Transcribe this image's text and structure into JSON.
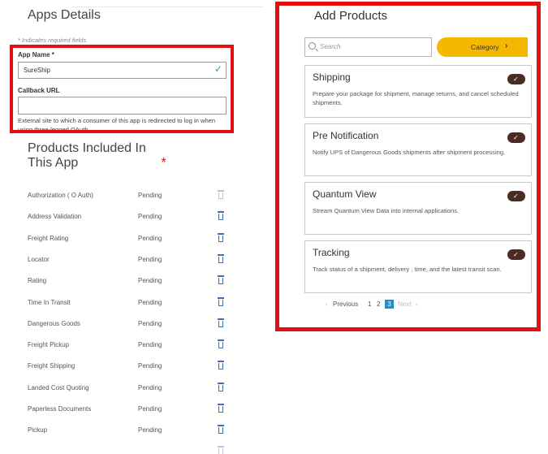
{
  "apps_details": {
    "title": "Apps Details",
    "required_note": "* Indicates required fields",
    "app_name_label": "App Name *",
    "app_name_value": "SureShip",
    "callback_label": "Callback URL",
    "callback_value": "",
    "callback_help": "External site to which a consumer of this app is redirected to log in when using three-legged OAuth"
  },
  "products_included": {
    "heading": "Products Included In This App",
    "required_star": "*",
    "rows": [
      {
        "name": "Authorization ( O Auth)",
        "status": "Pending",
        "removable": false
      },
      {
        "name": "Address Validation",
        "status": "Pending",
        "removable": true
      },
      {
        "name": "Freight Rating",
        "status": "Pending",
        "removable": true
      },
      {
        "name": "Locator",
        "status": "Pending",
        "removable": true
      },
      {
        "name": "Rating",
        "status": "Pending",
        "removable": true
      },
      {
        "name": "Time In Transit",
        "status": "Pending",
        "removable": true
      },
      {
        "name": "Dangerous Goods",
        "status": "Pending",
        "removable": true
      },
      {
        "name": "Freight Pickup",
        "status": "Pending",
        "removable": true
      },
      {
        "name": "Freight Shipping",
        "status": "Pending",
        "removable": true
      },
      {
        "name": "Landed Cost Quoting",
        "status": "Pending",
        "removable": true
      },
      {
        "name": "Paperless Documents",
        "status": "Pending",
        "removable": true
      },
      {
        "name": "Pickup",
        "status": "Pending",
        "removable": true
      }
    ]
  },
  "add_products": {
    "title": "Add Products",
    "search_placeholder": "Search",
    "category_label": "Category",
    "category_chevron": "›",
    "cards": [
      {
        "title": "Shipping",
        "description": "Prepare your package for shipment, manage returns, and cancel scheduled shipments.",
        "selected": true
      },
      {
        "title": "Pre Notification",
        "description": "Notify UPS of Dangerous Goods shipments after shipment processing.",
        "selected": true
      },
      {
        "title": "Quantum View",
        "description": "Stream Quantum View Data into internal applications.",
        "selected": true
      },
      {
        "title": "Tracking",
        "description": "Track status of a shipment, delivery , time, and the latest transit scan.",
        "selected": true
      }
    ],
    "pagination": {
      "prev_arrow": "‹",
      "previous": "Previous",
      "pages": [
        "1",
        "2",
        "3"
      ],
      "current_page": "3",
      "next": "Next",
      "next_arrow": "›"
    }
  },
  "colors": {
    "highlight_red": "#e31010",
    "category_yellow": "#f5b800",
    "toggle_brown": "#4a2c22",
    "trash_blue": "#3f6fb0",
    "check_green": "#3aa34a",
    "active_page_blue": "#1e90c8"
  },
  "icons": {
    "valid": "check-icon",
    "remove": "trash-icon",
    "search": "search-icon",
    "selected": "check-icon"
  }
}
